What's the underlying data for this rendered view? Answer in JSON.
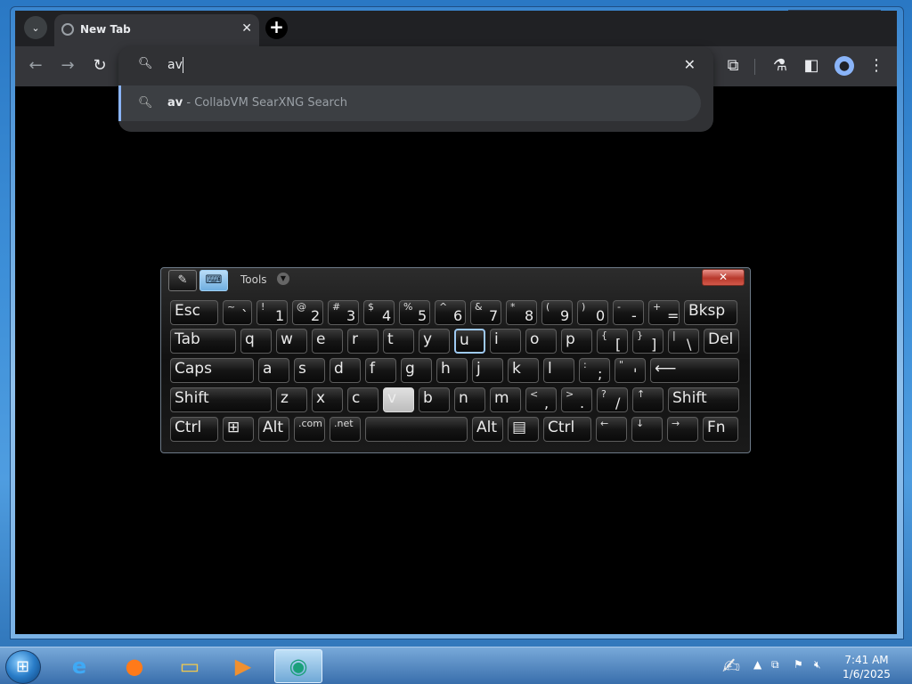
{
  "browser": {
    "tab_title": "New Tab",
    "omnibox_query": "av",
    "suggestion_query": "av",
    "suggestion_suffix": " - CollabVM SearXNG Search"
  },
  "osk": {
    "tools_label": "Tools",
    "rows": [
      [
        {
          "m": "Esc",
          "w": 54
        },
        {
          "m": "` ",
          "s": "~",
          "w": 33
        },
        {
          "m": "1",
          "s": "!",
          "w": 35
        },
        {
          "m": "2",
          "s": "@",
          "w": 35
        },
        {
          "m": "3",
          "s": "#",
          "w": 35
        },
        {
          "m": "4",
          "s": "$",
          "w": 35
        },
        {
          "m": "5",
          "s": "%",
          "w": 35
        },
        {
          "m": "6",
          "s": "^",
          "w": 35
        },
        {
          "m": "7",
          "s": "&",
          "w": 35
        },
        {
          "m": "8",
          "s": "*",
          "w": 35
        },
        {
          "m": "9",
          "s": "(",
          "w": 35
        },
        {
          "m": "0",
          "s": ")",
          "w": 35
        },
        {
          "m": "- ",
          "s": "-",
          "w": 35
        },
        {
          "m": "=",
          "s": "+",
          "w": 35
        },
        {
          "m": "Bksp",
          "w": 60
        }
      ],
      [
        {
          "m": "Tab",
          "w": 74
        },
        {
          "m": "q",
          "w": 35
        },
        {
          "m": "w",
          "w": 35
        },
        {
          "m": "e",
          "w": 35
        },
        {
          "m": "r",
          "w": 35
        },
        {
          "m": "t",
          "w": 35
        },
        {
          "m": "y",
          "w": 35
        },
        {
          "m": "u",
          "w": 35,
          "state": "hover"
        },
        {
          "m": "i",
          "w": 35
        },
        {
          "m": "o",
          "w": 35
        },
        {
          "m": "p",
          "w": 35
        },
        {
          "m": "[",
          "s": "{",
          "w": 35
        },
        {
          "m": "]",
          "s": "}",
          "w": 35
        },
        {
          "m": "\\",
          "s": "|",
          "w": 35
        },
        {
          "m": "Del",
          "w": 40
        }
      ],
      [
        {
          "m": "Caps",
          "w": 94
        },
        {
          "m": "a",
          "w": 35
        },
        {
          "m": "s",
          "w": 35
        },
        {
          "m": "d",
          "w": 35
        },
        {
          "m": "f",
          "w": 35
        },
        {
          "m": "g",
          "w": 35
        },
        {
          "m": "h",
          "w": 35
        },
        {
          "m": "j",
          "w": 35
        },
        {
          "m": "k",
          "w": 35
        },
        {
          "m": "l",
          "w": 35
        },
        {
          "m": ";",
          "s": ":",
          "w": 35
        },
        {
          "m": "'",
          "s": "\"",
          "w": 35
        },
        {
          "m": "⟵",
          "w": 100
        }
      ],
      [
        {
          "m": "Shift",
          "w": 114
        },
        {
          "m": "z",
          "w": 35
        },
        {
          "m": "x",
          "w": 35
        },
        {
          "m": "c",
          "w": 35
        },
        {
          "m": "v",
          "w": 35,
          "state": "pressed"
        },
        {
          "m": "b",
          "w": 35
        },
        {
          "m": "n",
          "w": 35
        },
        {
          "m": "m",
          "w": 35
        },
        {
          "m": ",",
          "s": "<",
          "w": 35
        },
        {
          "m": ".",
          "s": ">",
          "w": 35
        },
        {
          "m": "/",
          "s": "?",
          "w": 35
        },
        {
          "m": "",
          "s": "↑",
          "w": 35
        },
        {
          "m": "Shift",
          "w": 80
        }
      ],
      [
        {
          "m": "Ctrl",
          "w": 54
        },
        {
          "m": "⊞",
          "w": 35
        },
        {
          "m": "Alt",
          "w": 35
        },
        {
          "m": "",
          "s": ".com",
          "w": 35
        },
        {
          "m": "",
          "s": ".net",
          "w": 35
        },
        {
          "m": "",
          "w": 115
        },
        {
          "m": "Alt",
          "w": 35
        },
        {
          "m": "▤",
          "w": 35
        },
        {
          "m": "Ctrl",
          "w": 54
        },
        {
          "m": "",
          "s": "←",
          "w": 35
        },
        {
          "m": "",
          "s": "↓",
          "w": 35
        },
        {
          "m": "",
          "s": "→",
          "w": 35
        },
        {
          "m": "Fn",
          "w": 40
        }
      ]
    ]
  },
  "taskbar": {
    "time": "7:41 AM",
    "date": "1/6/2025"
  },
  "icons": {
    "search": "search-icon",
    "back": "back-arrow-icon",
    "forward": "forward-arrow-icon",
    "reload": "reload-icon",
    "extensions": "extensions-icon",
    "labs": "labs-flask-icon",
    "sidepanel": "side-panel-icon",
    "profile": "profile-icon",
    "menu": "kebab-menu-icon"
  }
}
